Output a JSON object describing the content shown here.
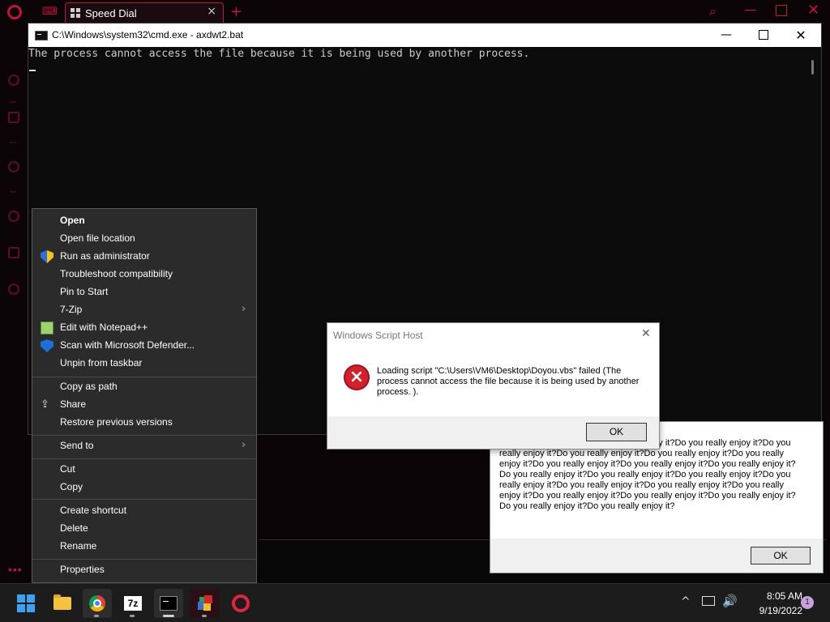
{
  "opera": {
    "tab_title": "Speed Dial",
    "new_tab": "+",
    "tab_close": "×",
    "window_min": "—",
    "window_close": "✕",
    "accent_color": "#c2123e"
  },
  "cmd": {
    "title": "C:\\Windows\\system32\\cmd.exe - axdwt2.bat",
    "output": "The process cannot access the file because it is being used by another process.",
    "min": "—",
    "close": "✕"
  },
  "wsh_dialog": {
    "title": "Windows Script Host",
    "close": "✕",
    "message": "Loading script \"C:\\Users\\VM6\\Desktop\\Doyou.vbs\" failed (The process cannot access the file because it is being used by another process. ).",
    "ok": "OK",
    "error_icon": "×"
  },
  "doyou_dialog": {
    "text": "Do you really enjoy it?Do you really enjoy it?Do you really enjoy it?Do you really enjoy it?Do you really enjoy it?Do you really enjoy it?Do you really enjoy it?Do you really enjoy it?Do you really enjoy it?Do you really enjoy it?Do you really enjoy it?Do you really enjoy it?Do you really enjoy it?Do you really enjoy it?Do you really enjoy it?Do you really enjoy it?Do you really enjoy it?Do you really enjoy it?Do you really enjoy it?Do you really enjoy it?Do you really enjoy it?Do you really enjoy it?",
    "ok": "OK"
  },
  "context_menu": {
    "items": [
      {
        "label": "Open",
        "icon": "none"
      },
      {
        "label": "Open file location",
        "icon": "none"
      },
      {
        "label": "Run as administrator",
        "icon": "uac-shield-icon"
      },
      {
        "label": "Troubleshoot compatibility",
        "icon": "none"
      },
      {
        "label": "Pin to Start",
        "icon": "none"
      },
      {
        "label": "7-Zip",
        "icon": "none",
        "submenu": true
      },
      {
        "label": "Edit with Notepad++",
        "icon": "notepad-plus-plus-icon"
      },
      {
        "label": "Scan with Microsoft Defender...",
        "icon": "defender-icon"
      },
      {
        "label": "Unpin from taskbar",
        "icon": "none"
      },
      {
        "label": "Copy as path",
        "icon": "none"
      },
      {
        "label": "Share",
        "icon": "share-icon"
      },
      {
        "label": "Restore previous versions",
        "icon": "none"
      },
      {
        "label": "Send to",
        "icon": "none",
        "submenu": true
      },
      {
        "label": "Cut",
        "icon": "none"
      },
      {
        "label": "Copy",
        "icon": "none"
      },
      {
        "label": "Create shortcut",
        "icon": "none"
      },
      {
        "label": "Delete",
        "icon": "none"
      },
      {
        "label": "Rename",
        "icon": "none"
      },
      {
        "label": "Properties",
        "icon": "none"
      }
    ],
    "submenu_arrow": "›"
  },
  "taskbar": {
    "sevenzip_label": "7z",
    "tray_chevron": "^",
    "volume_icon": "🔊",
    "time": "8:05 AM",
    "date": "9/19/2022",
    "notification_count": "1"
  },
  "misc": {
    "left_dots": "•••"
  }
}
